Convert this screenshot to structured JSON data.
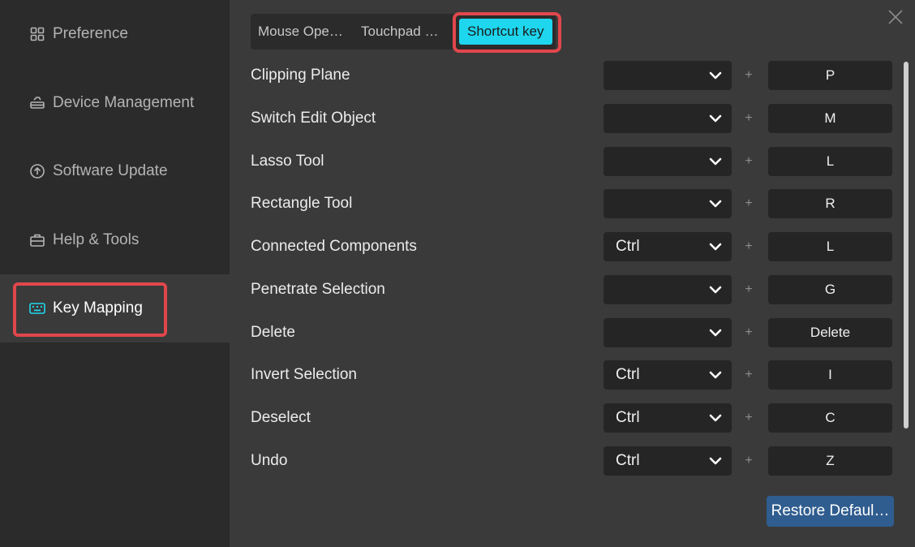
{
  "sidebar": {
    "items": [
      {
        "label": "Preference",
        "icon": "grid-icon"
      },
      {
        "label": "Device Management",
        "icon": "scanner-icon"
      },
      {
        "label": "Software Update",
        "icon": "update-icon"
      },
      {
        "label": "Help & Tools",
        "icon": "toolbox-icon"
      },
      {
        "label": "Key Mapping",
        "icon": "keyboard-icon",
        "active": true
      }
    ]
  },
  "tabs": [
    {
      "label": "Mouse Ope…"
    },
    {
      "label": "Touchpad …"
    },
    {
      "label": "Shortcut key",
      "active": true
    }
  ],
  "plus_sign": "+",
  "shortcuts": [
    {
      "label": "Clipping Plane",
      "modifier": "",
      "key": "P"
    },
    {
      "label": "Switch Edit Object",
      "modifier": "",
      "key": "M"
    },
    {
      "label": "Lasso Tool",
      "modifier": "",
      "key": "L"
    },
    {
      "label": "Rectangle Tool",
      "modifier": "",
      "key": "R"
    },
    {
      "label": "Connected Components",
      "modifier": "Ctrl",
      "key": "L"
    },
    {
      "label": "Penetrate Selection",
      "modifier": "",
      "key": "G"
    },
    {
      "label": "Delete",
      "modifier": "",
      "key": "Delete"
    },
    {
      "label": "Invert Selection",
      "modifier": "Ctrl",
      "key": "I"
    },
    {
      "label": "Deselect",
      "modifier": "Ctrl",
      "key": "C"
    },
    {
      "label": "Undo",
      "modifier": "Ctrl",
      "key": "Z"
    }
  ],
  "restore_label": "Restore Defaul…",
  "colors": {
    "accent": "#1ed6ee",
    "highlight": "#e0474b",
    "button": "#2f5d8f"
  }
}
